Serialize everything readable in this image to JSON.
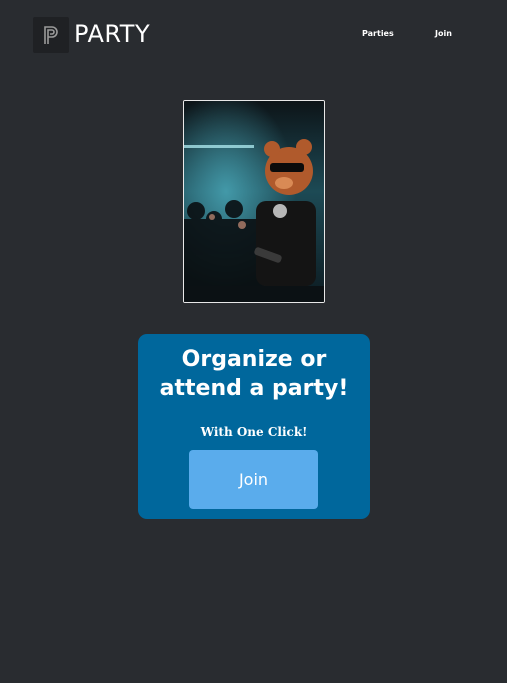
{
  "nav": {
    "brand": "PARTY",
    "logo_letter": "P",
    "links": [
      {
        "label": "Parties"
      },
      {
        "label": "Join"
      }
    ]
  },
  "hero": {
    "image_icon": "party-photo"
  },
  "card": {
    "title_line1": "Organize or",
    "title_line2": "attend a party!",
    "subtitle": "With One Click!",
    "button_label": "Join"
  },
  "colors": {
    "background": "#292c30",
    "card": "#00679c",
    "button": "#5aacec",
    "text": "#ffffff"
  }
}
